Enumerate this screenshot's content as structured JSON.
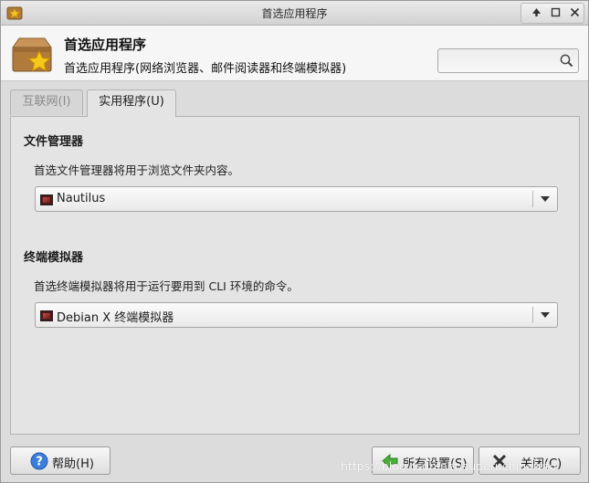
{
  "window": {
    "title": "首选应用程序"
  },
  "header": {
    "title": "首选应用程序",
    "subtitle": "首选应用程序(网络浏览器、邮件阅读器和终端模拟器)",
    "search_placeholder": ""
  },
  "tabs": [
    {
      "label": "互联网(I)",
      "active": false
    },
    {
      "label": "实用程序(U)",
      "active": true
    }
  ],
  "file_manager": {
    "title": "文件管理器",
    "description": "首选文件管理器将用于浏览文件夹内容。",
    "selected": "Nautilus"
  },
  "terminal": {
    "title": "终端模拟器",
    "description": "首选终端模拟器将用于运行要用到 CLI 环境的命令。",
    "selected": "Debian X 终端模拟器"
  },
  "buttons": {
    "help": "帮助(H)",
    "all_settings": "所有设置(S)",
    "close": "关闭(C)"
  },
  "watermark": "https://blog.csdn.net/superuchiharuto",
  "colors": {
    "window_bg": "#dcdcdc",
    "header_bg": "#f6f6f6",
    "accent_star": "#f5c21a"
  }
}
